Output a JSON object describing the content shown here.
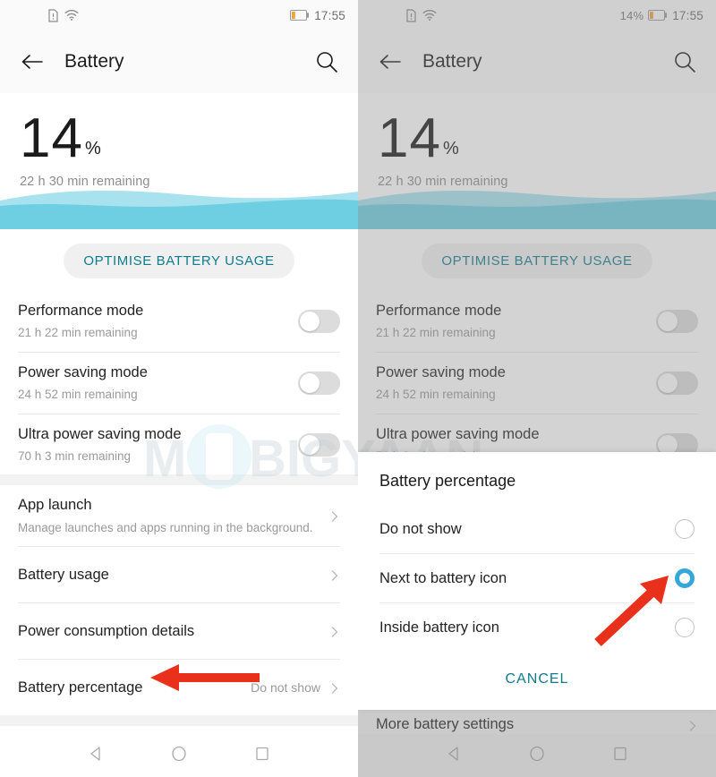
{
  "statusbar": {
    "icons": [
      "sim-card-icon",
      "wifi-icon",
      "battery-icon"
    ],
    "battery_percent_left": "",
    "battery_percent_right": "14%",
    "clock": "17:55"
  },
  "appbar": {
    "title": "Battery",
    "back_icon": "back-arrow-icon",
    "search_icon": "search-icon"
  },
  "hero": {
    "level": "14",
    "percent_sign": "%",
    "remaining": "22 h 30 min remaining"
  },
  "optimise": {
    "label": "OPTIMISE BATTERY USAGE"
  },
  "modes": [
    {
      "title": "Performance mode",
      "sub": "21 h 22 min remaining",
      "toggle": "off"
    },
    {
      "title": "Power saving mode",
      "sub": "24 h 52 min remaining",
      "toggle": "off"
    },
    {
      "title": "Ultra power saving mode",
      "sub": "70 h 3 min remaining",
      "toggle": "off"
    }
  ],
  "settings": [
    {
      "title": "App launch",
      "sub": "Manage launches and apps running in the background.",
      "value": ""
    },
    {
      "title": "Battery usage",
      "sub": "",
      "value": ""
    },
    {
      "title": "Power consumption details",
      "sub": "",
      "value": ""
    },
    {
      "title": "Battery percentage",
      "sub": "",
      "value": "Do not show"
    }
  ],
  "more": {
    "title": "More battery settings"
  },
  "dialog": {
    "title": "Battery percentage",
    "options": [
      {
        "label": "Do not show",
        "selected": false
      },
      {
        "label": "Next to battery icon",
        "selected": true
      },
      {
        "label": "Inside battery icon",
        "selected": false
      }
    ],
    "cancel_label": "CANCEL"
  },
  "navbar": {
    "back_icon": "nav-back-triangle-icon",
    "home_icon": "nav-home-circle-icon",
    "recents_icon": "nav-recents-square-icon"
  },
  "watermark": {
    "text": "MOBIGYAAN"
  },
  "colors": {
    "accent_teal": "#0f7b8f",
    "radio_selected": "#35a8da",
    "wave": "#6ecfe3",
    "arrow_red": "#e8301a",
    "battery_orange": "#f2a33c"
  }
}
